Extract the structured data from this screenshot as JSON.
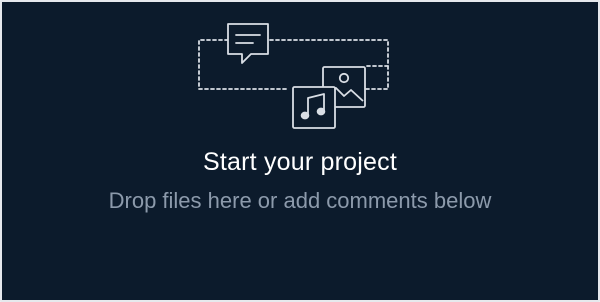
{
  "dropzone": {
    "title": "Start your project",
    "subtitle": "Drop files here or add comments below",
    "icons": [
      "comment-icon",
      "image-file-icon",
      "music-file-icon"
    ]
  },
  "colors": {
    "background": "#0c1b2c",
    "title": "#ffffff",
    "subtitle": "#8c9aab",
    "icon_stroke": "#d9dee5",
    "frame_border": "#e6e9ed"
  }
}
